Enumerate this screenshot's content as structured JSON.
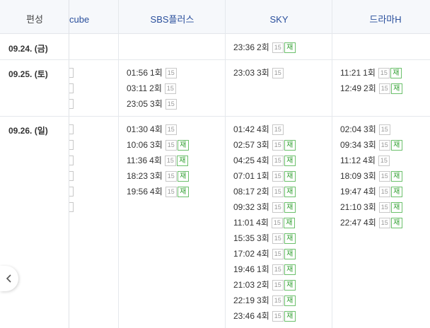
{
  "header": {
    "first_col": "편성",
    "channels": [
      "cube",
      "SBS플러스",
      "SKY",
      "드라마H"
    ]
  },
  "badges": {
    "age": "15",
    "rerun": "재"
  },
  "rows": [
    {
      "date": "09.24. (금)",
      "sbs": [],
      "sky": [
        {
          "time": "23:36",
          "ep": "2회",
          "re": true
        }
      ],
      "dramah": []
    },
    {
      "date": "09.25. (토)",
      "sbs": [
        {
          "time": "01:56",
          "ep": "1회",
          "re": false
        },
        {
          "time": "03:11",
          "ep": "2회",
          "re": false
        },
        {
          "time": "23:05",
          "ep": "3회",
          "re": false
        }
      ],
      "sky": [
        {
          "time": "23:03",
          "ep": "3회",
          "re": false
        }
      ],
      "dramah": [
        {
          "time": "11:21",
          "ep": "1회",
          "re": true
        },
        {
          "time": "12:49",
          "ep": "2회",
          "re": true
        }
      ]
    },
    {
      "date": "09.26. (일)",
      "sbs": [
        {
          "time": "01:30",
          "ep": "4회",
          "re": false
        },
        {
          "time": "10:06",
          "ep": "3회",
          "re": true
        },
        {
          "time": "11:36",
          "ep": "4회",
          "re": true
        },
        {
          "time": "18:23",
          "ep": "3회",
          "re": true
        },
        {
          "time": "19:56",
          "ep": "4회",
          "re": true
        }
      ],
      "sky": [
        {
          "time": "01:42",
          "ep": "4회",
          "re": false
        },
        {
          "time": "02:57",
          "ep": "3회",
          "re": true
        },
        {
          "time": "04:25",
          "ep": "4회",
          "re": true
        },
        {
          "time": "07:01",
          "ep": "1회",
          "re": true
        },
        {
          "time": "08:17",
          "ep": "2회",
          "re": true
        },
        {
          "time": "09:32",
          "ep": "3회",
          "re": true
        },
        {
          "time": "11:01",
          "ep": "4회",
          "re": true
        },
        {
          "time": "15:35",
          "ep": "3회",
          "re": true
        },
        {
          "time": "17:02",
          "ep": "4회",
          "re": true
        },
        {
          "time": "19:46",
          "ep": "1회",
          "re": true
        },
        {
          "time": "21:03",
          "ep": "2회",
          "re": true
        },
        {
          "time": "22:19",
          "ep": "3회",
          "re": true
        },
        {
          "time": "23:46",
          "ep": "4회",
          "re": true
        }
      ],
      "dramah": [
        {
          "time": "02:04",
          "ep": "3회",
          "re": false
        },
        {
          "time": "09:34",
          "ep": "3회",
          "re": true
        },
        {
          "time": "11:12",
          "ep": "4회",
          "re": false
        },
        {
          "time": "18:09",
          "ep": "3회",
          "re": true
        },
        {
          "time": "19:47",
          "ep": "4회",
          "re": true
        },
        {
          "time": "21:10",
          "ep": "3회",
          "re": true
        },
        {
          "time": "22:47",
          "ep": "4회",
          "re": true
        }
      ]
    }
  ],
  "nav": {
    "prev_icon": "chevron-left-icon"
  }
}
